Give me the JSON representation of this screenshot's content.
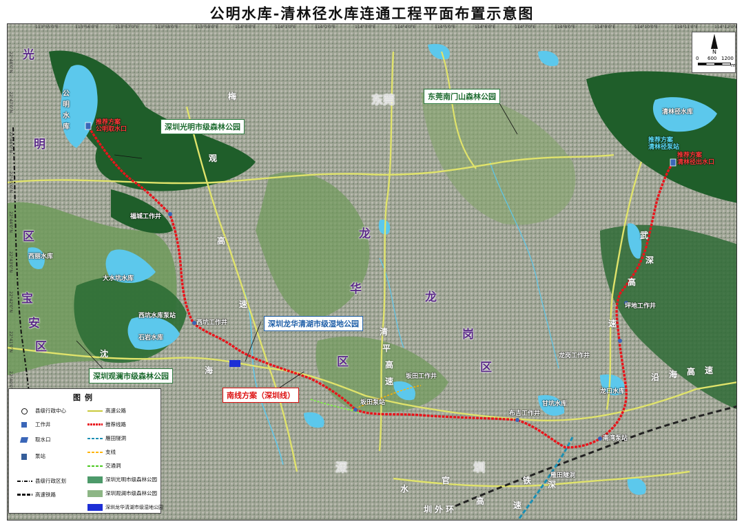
{
  "title": "公明水库-清林径水库连通工程平面布置示意图",
  "colors": {
    "route": "#e8141b",
    "expressway": "#e0e36b",
    "water": "#5cc8ec",
    "forest_dark": "#1f5e2a",
    "forest_light": "#6f9a5a",
    "wetland": "#1d2fd6",
    "district": "#5a2a87"
  },
  "coords": {
    "top": [
      "113°55'0\"E",
      "113°56'0\"E",
      "113°57'0\"E",
      "113°58'0\"E",
      "113°59'0\"E",
      "114°0'0\"E",
      "114°1'0\"E",
      "114°2'0\"E",
      "114°3'0\"E",
      "114°4'0\"E",
      "114°5'0\"E",
      "114°6'0\"E",
      "114°7'0\"E",
      "114°8'0\"E",
      "114°9'0\"E",
      "114°10'0\"E",
      "114°11'0\"E",
      "114°12'0\"E"
    ],
    "left": [
      "22°48'0\"N",
      "22°47'0\"N",
      "22°46'0\"N",
      "22°45'0\"N",
      "22°44'0\"N",
      "22°43'0\"N",
      "22°42'0\"N",
      "22°41'0\"N",
      "22°40'0\"N",
      "22°39'0\"N",
      "22°38'0\"N",
      "22°37'0\"N"
    ]
  },
  "scale": {
    "north": "N",
    "zero": "0",
    "mid": "600",
    "end": "1200",
    "unit": "m"
  },
  "callouts": {
    "guangming_forest": "深圳光明市级森林公园",
    "dongguan_forest": "东莞南门山森林公园",
    "longhua_wetland": "深圳龙华清湖市级湿地公园",
    "guanlan_forest": "深圳观澜市级森林公园",
    "south_line": "南线方案（深圳线）"
  },
  "districts": {
    "guangming": [
      "光",
      "明",
      "区"
    ],
    "baoan": [
      "宝",
      "安",
      "区"
    ],
    "longhua": [
      "龙",
      "华",
      "区"
    ],
    "longgang": [
      "龙",
      "岗",
      "区"
    ],
    "dongguan_top": "东莞",
    "shenzhen_bottom": [
      "深",
      "圳"
    ]
  },
  "road_chars": {
    "guanlan": [
      "梅",
      "观",
      "高",
      "速"
    ],
    "qingping": [
      "清",
      "平",
      "高",
      "速"
    ],
    "wushen": [
      "武",
      "深",
      "高",
      "速"
    ],
    "shenhai": [
      "沈",
      "海"
    ],
    "shuiguan": [
      "水",
      "官",
      "高",
      "速"
    ],
    "yanshen": [
      "沿",
      "海",
      "高",
      "速"
    ],
    "ring": [
      "深",
      "圳",
      "外",
      "环"
    ],
    "railway": [
      "铁"
    ]
  },
  "reservoirs": {
    "gongming": "公明水库",
    "qinglinjing": "清林径水库",
    "xili": "西丽水库",
    "dashiyuan": "大水坑水库",
    "shiyan": "石岩水库",
    "longkou": "龙口水库",
    "tianma": "甘坑水库"
  },
  "features": {
    "gongming_intake": "推荐方案\n公明取水口",
    "qinglinjing_station": "推荐方案\n清林径泵站",
    "qinglinjing_outlet": "推荐方案\n清林径出水口",
    "fuyong_well": "福城工作井",
    "xikeng_station": "西坑水库泵站",
    "xikeng_well": "西坑工作井",
    "bantian_station": "坂田泵站",
    "bantian_well": "坂田工作井",
    "pingdi_well": "坪地工作井",
    "nanwan_station": "南湾泵站",
    "longgang_well": "龙岗工作井",
    "yantian_tunnel": "雁田隧洞",
    "shenzhen_well": "布吉工作井"
  },
  "legend": {
    "title": "图例",
    "items": [
      {
        "label": "县级行政中心"
      },
      {
        "label": "高速公路"
      },
      {
        "label": "工作井"
      },
      {
        "label": "推荐线路"
      },
      {
        "label": "取水口"
      },
      {
        "label": "雁田隧洞"
      },
      {
        "label": "泵站"
      },
      {
        "label": "支线"
      },
      {
        "label": "交通洞"
      },
      {
        "label": "县级行政区划"
      },
      {
        "label": "深圳光明市级森林公园"
      },
      {
        "label": "高速铁路"
      },
      {
        "label": "深圳观澜市级森林公园"
      },
      {
        "label": "深圳龙华清湖市级湿地公园"
      }
    ]
  }
}
